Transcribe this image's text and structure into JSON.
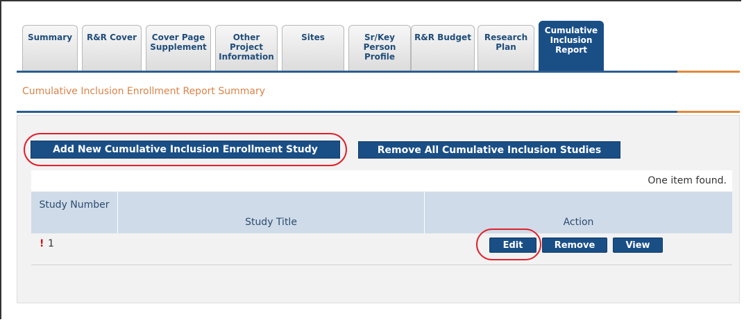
{
  "tabs": [
    {
      "label": "Summary"
    },
    {
      "label": "R&R Cover"
    },
    {
      "label": "Cover Page Supplement"
    },
    {
      "label": "Other Project Information"
    },
    {
      "label": "Sites"
    },
    {
      "label": "Sr/Key Person Profile"
    },
    {
      "label": "R&R Budget"
    },
    {
      "label": "Research Plan"
    },
    {
      "label": "Cumulative Inclusion Report"
    }
  ],
  "section_title": "Cumulative Inclusion Enrollment Report Summary",
  "buttons": {
    "add_study": "Add New Cumulative Inclusion Enrollment Study",
    "remove_all": "Remove All Cumulative Inclusion Studies"
  },
  "found_text": "One item found.",
  "table": {
    "columns": [
      "Study Number",
      "Study Title",
      "Action"
    ],
    "rows": [
      {
        "warning": "!",
        "number": "1",
        "edit": "Edit",
        "remove": "Remove",
        "view": "View"
      }
    ]
  },
  "colors": {
    "primary": "#1a4f86",
    "accent": "#e08a3c",
    "highlight": "#e0202a"
  }
}
